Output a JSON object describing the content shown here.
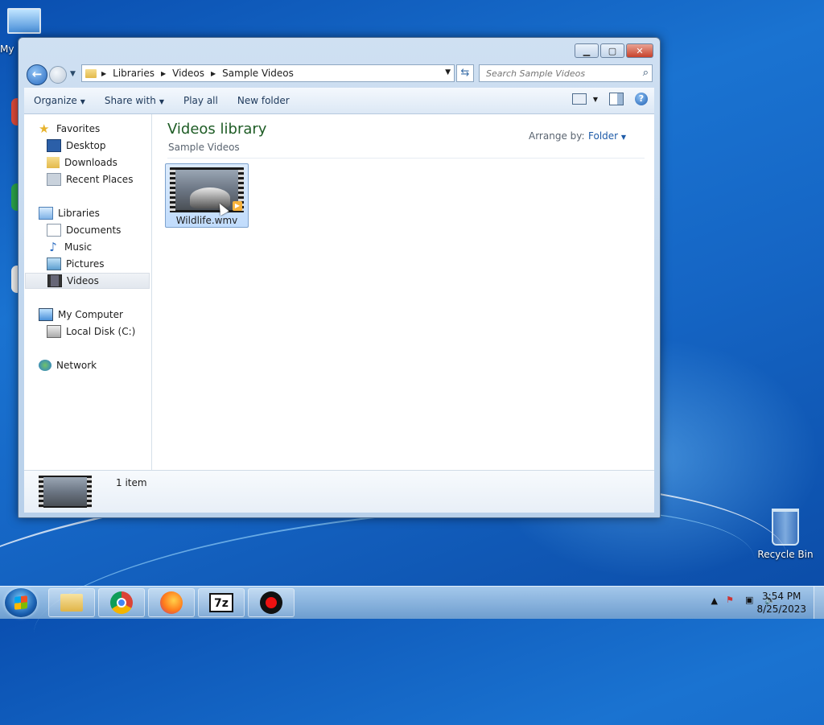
{
  "desktop": {
    "my_computer_label": "My",
    "recycle_bin_label": "Recycle Bin"
  },
  "window": {
    "caption_buttons": {
      "minimize": "▁",
      "maximize": "▢",
      "close": "✕"
    },
    "address": {
      "crumbs": [
        "Libraries",
        "Videos",
        "Sample Videos"
      ]
    },
    "search": {
      "placeholder": "Search Sample Videos"
    },
    "toolbar": {
      "organize": "Organize",
      "share_with": "Share with",
      "play_all": "Play all",
      "new_folder": "New folder"
    },
    "nav": {
      "favorites": "Favorites",
      "desktop": "Desktop",
      "downloads": "Downloads",
      "recent_places": "Recent Places",
      "libraries": "Libraries",
      "documents": "Documents",
      "music": "Music",
      "pictures": "Pictures",
      "videos": "Videos",
      "my_computer": "My Computer",
      "local_disk": "Local Disk (C:)",
      "network": "Network"
    },
    "content": {
      "title": "Videos library",
      "subtitle": "Sample Videos",
      "arrange_by_label": "Arrange by:",
      "arrange_by_value": "Folder",
      "files": [
        {
          "name": "Wildlife.wmv",
          "selected": true
        }
      ]
    },
    "details": {
      "item_count": "1 item"
    }
  },
  "taskbar": {
    "apps": [
      "windows-explorer",
      "google-chrome",
      "firefox",
      "7-zip",
      "screen-recorder"
    ],
    "clock_time": "3:54 PM",
    "clock_date": "8/25/2023"
  },
  "colors": {
    "library_title": "#1e5c25",
    "link_blue": "#1e5ba8",
    "selection": "#c1dcfc"
  }
}
